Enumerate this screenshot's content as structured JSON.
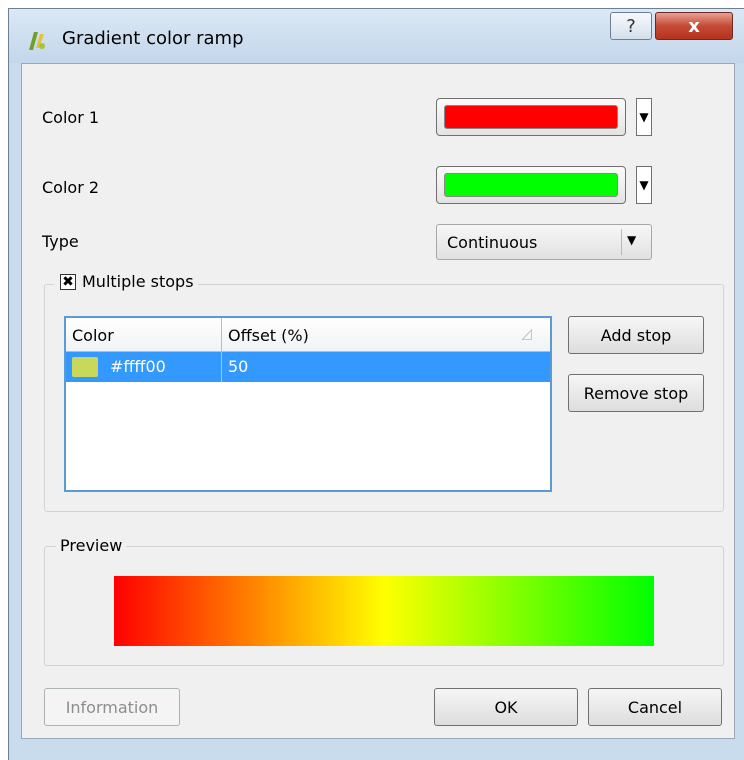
{
  "window": {
    "title": "Gradient color ramp",
    "help_glyph": "?",
    "close_glyph": "x"
  },
  "color1": {
    "label": "Color 1",
    "value": "#ff0000"
  },
  "color2": {
    "label": "Color 2",
    "value": "#00ff00"
  },
  "type": {
    "label": "Type",
    "selected": "Continuous"
  },
  "stops": {
    "group_label": "Multiple stops",
    "checked": true,
    "columns": [
      "Color",
      "Offset (%)"
    ],
    "rows": [
      {
        "color": "#ffff00",
        "swatch": "#c8d85a",
        "offset": "50"
      }
    ],
    "add_label": "Add stop",
    "remove_label": "Remove stop"
  },
  "preview": {
    "label": "Preview",
    "gradient": [
      "#ff0000",
      "#ffff00",
      "#00ff00"
    ]
  },
  "footer": {
    "information_label": "Information",
    "ok_label": "OK",
    "cancel_label": "Cancel"
  }
}
